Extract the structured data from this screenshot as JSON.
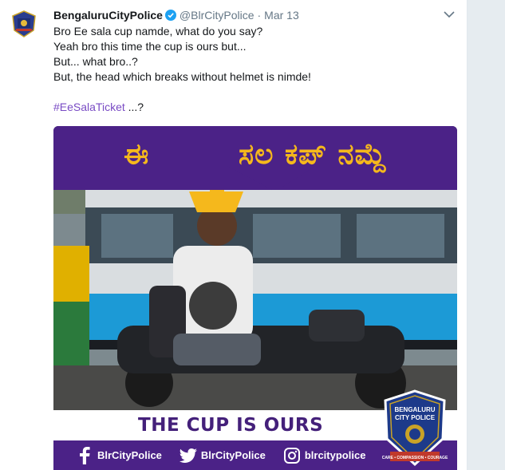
{
  "tweet": {
    "author_name": "BengaluruCityPolice",
    "handle": "@BlrCityPolice",
    "separator": "·",
    "time": "Mar 13",
    "lines": [
      "Bro Ee sala cup namde, what do you say?",
      "Yeah bro this time the cup is ours but...",
      "But... what bro..?",
      "But, the head which breaks without helmet is nimde!"
    ],
    "hashtag": "#EeSalaTicket",
    "hashtag_suffix": " ...?"
  },
  "media": {
    "kannada_left": "ಈ",
    "kannada_right": "ಸಲ ಕಪ್ ನಮ್ದೆ",
    "cup_text": "THE CUP IS OURS",
    "social": [
      {
        "icon": "facebook-icon",
        "label": "BlrCityPolice"
      },
      {
        "icon": "twitter-icon",
        "label": "BlrCityPolice"
      },
      {
        "icon": "instagram-icon",
        "label": "blrcitypolice"
      }
    ],
    "badge": {
      "top_text": "BENGALURU",
      "main_text": "CITY POLICE",
      "motto": "CARE • COMPASSION • COURAGE"
    }
  },
  "colors": {
    "banner_purple": "#4b2287",
    "gold": "#f5b81c",
    "hashtag": "#794bc4",
    "verified_blue": "#1da1f2"
  }
}
